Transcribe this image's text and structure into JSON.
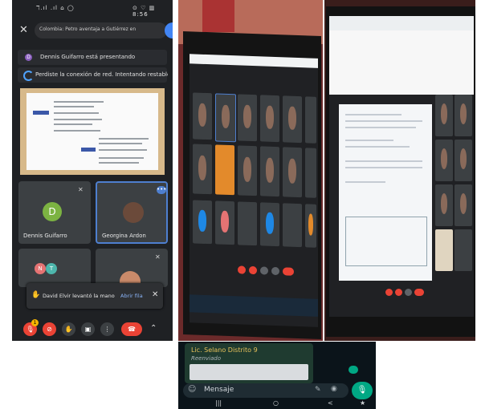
{
  "meet_phone": {
    "status_left": "ℸ.ıl .ıl ⌂ ◯",
    "status_right": "⊙ ♡ ▥ 8:56",
    "search_text": "Colombia: Petro aventaja a Gutiérrez en",
    "presenting": {
      "avatar_letter": "D",
      "text": "Dennis Guifarro está presentando"
    },
    "network_text": "Perdiste la conexión de red. Intentando restablecerla...",
    "slide_lines": [
      "CEBG · 2018 · 2019-2020 · 2022",
      "Dirección Municipal de la Libertad",
      "Maestra",
      "MPG · 2010 · 2018-2019 · 2022",
      "Dirección Municipal de Manzano",
      "CIDE · 2019 · 2019-2020 · 2022",
      "Dirección Municipal del Parque",
      "CEBG · 2011 · 2018-2019 · 2022 · 21",
      "Dirección Distrital del Distrito Central N",
      "Distrito",
      "CB · 2011 · 2018-2019 · 2022 · 21",
      "Dirección Distrital del Distrito Central N"
    ],
    "participants": [
      {
        "name": "Dennis Guifarro",
        "avatar_letter": "D"
      },
      {
        "name": "Georgina Ardon",
        "avatar_letter": ""
      },
      {
        "avatar_letters": [
          "N",
          "T"
        ]
      },
      {
        "name": ""
      }
    ],
    "hand_raised": {
      "text": "David Elvir levantó la mano",
      "action": "Abrir fila"
    },
    "controls": {
      "badge_count": "1"
    }
  },
  "whatsapp": {
    "sender": "Lic. Selano Distrito 9",
    "forwarded": "Reenviado",
    "input_placeholder": "Mensaje",
    "nav": [
      "|||",
      "○",
      "<",
      "★"
    ]
  },
  "colors": {
    "meet_bg": "#1f2124",
    "meet_blue": "#4285f4",
    "end_red": "#ea4335",
    "wa_green": "#00a884",
    "wa_sender": "#e7c15a"
  }
}
